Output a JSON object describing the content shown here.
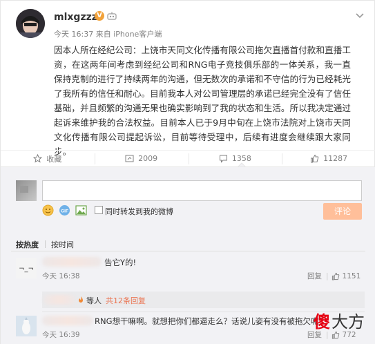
{
  "post": {
    "username": "mlxgzzz",
    "verified_badge": "V",
    "time": "今天 16:37",
    "source": "来自 iPhone客户端",
    "content": "因本人所在经纪公司：上饶市天同文化传播有限公司拖欠直播首付款和直播工资，在这两年间考虑到经纪公司和RNG电子竞技俱乐部的一体关系，我一直保持克制的进行了持续两年的沟通，但无数次的承诺和不守信的行为已经耗光了我所有的信任和耐心。目前我本人对公司管理层的承诺已经完全没有了信任基础，并且频繁的沟通无果也确实影响到了我的状态和生活。所以我决定通过起诉来维护我的合法权益。目前本人已于9月中旬在上饶市法院对上饶市天同文化传播有限公司提起诉讼，目前等待受理中，后续有进度会继续跟大家同步。"
  },
  "actions": {
    "favorite": "收藏",
    "repost": "2009",
    "comment": "1358",
    "like": "11287"
  },
  "composer": {
    "placeholder": "",
    "share_label": "同时转发到我的微博",
    "submit": "评论"
  },
  "sort": {
    "hot": "按热度",
    "time": "按时间"
  },
  "comments": [
    {
      "text": "告它Y的!",
      "time": "今天 16:38",
      "reply_label": "回复",
      "likes": "1151",
      "replies": {
        "prefix": "等人",
        "link": "共12条回复"
      }
    },
    {
      "text": "RNG想干嘛啊。就想把你们都逼走么？话说儿姿有没有被拖欠呢？",
      "time": "今天 16:39",
      "reply_label": "回复",
      "likes": "772"
    }
  ],
  "watermark": {
    "main": "傻",
    "sub": "大方"
  },
  "colors": {
    "accent": "#eb7350",
    "submit_bg": "#ffbf9a",
    "panel_bg": "#f2f2f5",
    "badge": "#f2a23a"
  }
}
